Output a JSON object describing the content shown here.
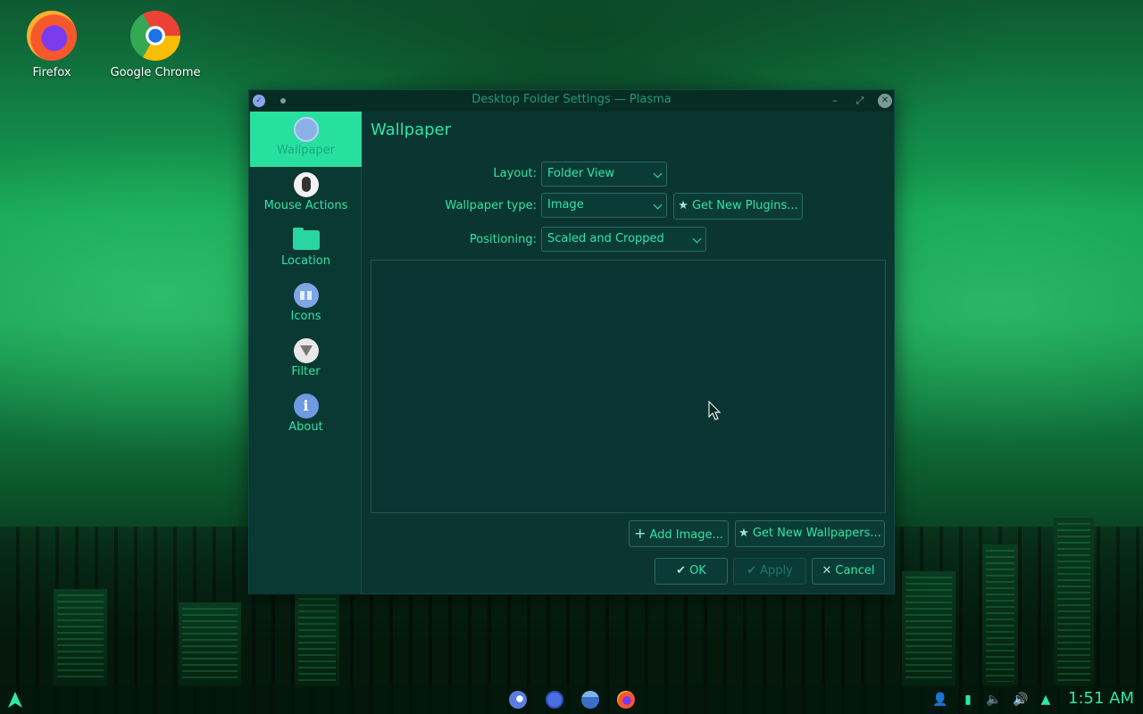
{
  "desktop": {
    "icons": [
      {
        "label": "Firefox",
        "icon": "firefox-icon"
      },
      {
        "label": "Google Chrome",
        "icon": "chrome-icon"
      }
    ]
  },
  "window": {
    "title": "Desktop Folder Settings — Plasma",
    "sidebar": {
      "items": [
        {
          "label": "Wallpaper",
          "icon": "wallpaper-icon",
          "active": true
        },
        {
          "label": "Mouse Actions",
          "icon": "mouse-icon"
        },
        {
          "label": "Location",
          "icon": "folder-icon"
        },
        {
          "label": "Icons",
          "icon": "icons-grid-icon"
        },
        {
          "label": "Filter",
          "icon": "filter-icon"
        },
        {
          "label": "About",
          "icon": "info-icon"
        }
      ]
    },
    "page": {
      "title": "Wallpaper",
      "layout_label": "Layout:",
      "layout_value": "Folder View",
      "wallpaper_type_label": "Wallpaper type:",
      "wallpaper_type_value": "Image",
      "get_plugins_label": "Get New Plugins...",
      "positioning_label": "Positioning:",
      "positioning_value": "Scaled and Cropped",
      "add_image_label": "Add Image...",
      "get_wallpapers_label": "Get New Wallpapers..."
    },
    "buttons": {
      "ok": "OK",
      "apply": "Apply",
      "cancel": "Cancel"
    }
  },
  "taskbar": {
    "clock": "1:51 AM"
  },
  "colors": {
    "accent": "#2ee6a6",
    "window_bg": "#0a3530",
    "active_sidebar": "#27e0a0"
  }
}
